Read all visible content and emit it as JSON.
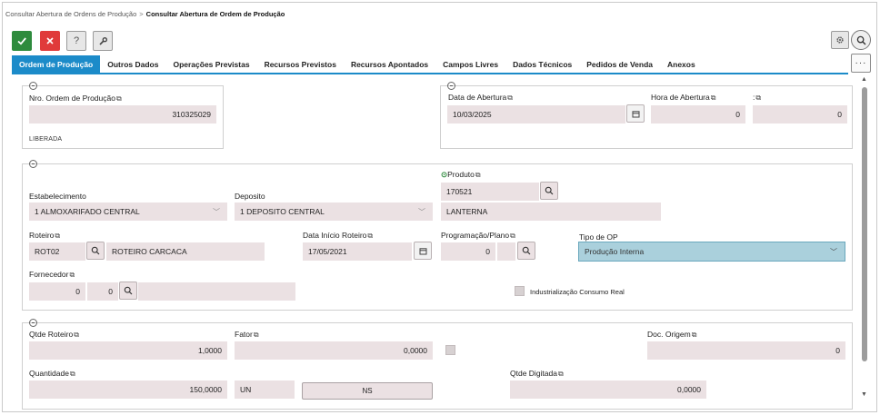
{
  "breadcrumb": {
    "parent": "Consultar Abertura de Ordens de Produção",
    "separator": ">",
    "current": "Consultar Abertura de Ordem de Produção"
  },
  "toolbar": {
    "confirm_icon": "check-icon",
    "cancel_icon": "close-icon",
    "help_label": "?",
    "tools_icon": "wrench-icon",
    "settings_icon": "gear-icon",
    "search_icon": "search-icon",
    "more_label": "···"
  },
  "tabs": [
    {
      "label": "Ordem de Produção",
      "active": true
    },
    {
      "label": "Outros Dados"
    },
    {
      "label": "Operações Previstas"
    },
    {
      "label": "Recursos Previstos"
    },
    {
      "label": "Recursos Apontados"
    },
    {
      "label": "Campos Livres"
    },
    {
      "label": "Dados Técnicos"
    },
    {
      "label": "Pedidos de Venda"
    },
    {
      "label": "Anexos"
    }
  ],
  "order": {
    "number_label": "Nro. Ordem de Produção",
    "number_value": "310325029",
    "status": "LIBERADA"
  },
  "opening": {
    "date_label": "Data de Abertura",
    "date_value": "10/03/2025",
    "time_label": "Hora de Abertura",
    "time_value": "0",
    "extra_label": ":",
    "extra_value": "0"
  },
  "product": {
    "product_label": "Produto",
    "product_code": "170521",
    "product_desc": "LANTERNA",
    "estab_label": "Estabelecimento",
    "estab_value": "1 ALMOXARIFADO CENTRAL",
    "deposit_label": "Deposito",
    "deposit_value": "1 DEPOSITO CENTRAL",
    "route_label": "Roteiro",
    "route_code": "ROT02",
    "route_desc": "ROTEIRO CARCACA",
    "route_start_label": "Data Início Roteiro",
    "route_start_value": "17/05/2021",
    "plan_label": "Programação/Plano",
    "plan_value": "0",
    "op_type_label": "Tipo de OP",
    "op_type_value": "Produção Interna",
    "supplier_label": "Fornecedor",
    "supplier_value_1": "0",
    "supplier_value_2": "0",
    "industrial_label": "Industrialização Consumo Real"
  },
  "quantities": {
    "route_qty_label": "Qtde Roteiro",
    "route_qty_value": "1,0000",
    "factor_label": "Fator",
    "factor_value": "0,0000",
    "doc_origin_label": "Doc. Origem",
    "doc_origin_value": "0",
    "qty_label": "Quantidade",
    "qty_value": "150,0000",
    "unit_value": "UN",
    "ns_label": "NS",
    "typed_qty_label": "Qtde Digitada",
    "typed_qty_value": "0,0000"
  },
  "colors": {
    "accent": "#1c8bc9",
    "confirm": "#2e8b3d",
    "cancel": "#e03a3a",
    "field_bg": "#ebe1e3",
    "select_bg": "#aad0dc"
  }
}
